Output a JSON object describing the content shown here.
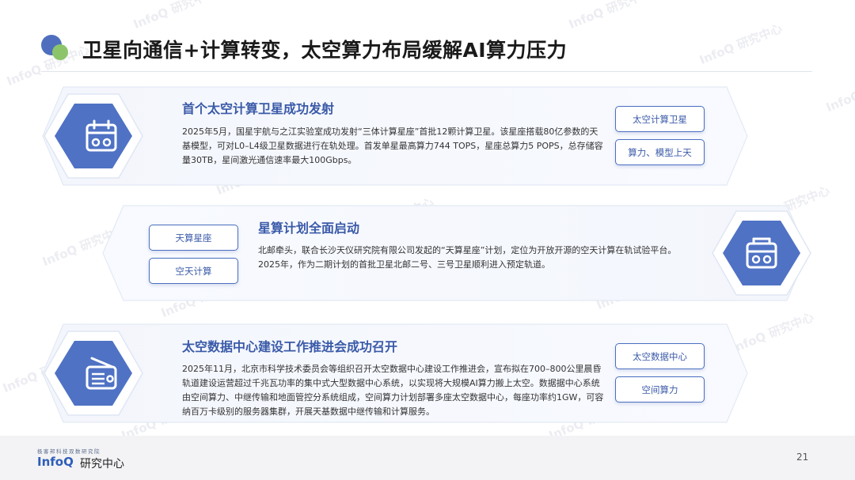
{
  "page": {
    "title": "卫星向通信+计算转变，太空算力布局缓解AI算力压力",
    "page_number": "21"
  },
  "watermark_text": "InfoQ 研究中心",
  "cards": [
    {
      "title": "首个太空计算卫星成功发射",
      "body": "2025年5月，国星宇航与之江实验室成功发射“三体计算星座”首批12颗计算卫星。该星座搭载80亿参数的天基模型，可对L0–L4级卫星数据进行在轨处理。首发单星最高算力744 TOPS，星座总算力5 POPS，总存储容量30TB，星间激光通信速率最大100Gbps。",
      "tags": [
        "太空计算卫星",
        "算力、模型上天"
      ],
      "icon": "calendar-icon"
    },
    {
      "title": "星算计划全面启动",
      "body": "北邮牵头，联合长沙天仪研究院有限公司发起的“天算星座”计划，定位为开放开源的空天计算在轨试验平台。2025年，作为二期计划的首批卫星北邮二号、三号卫星顺利进入预定轨道。",
      "tags": [
        "天算星座",
        "空天计算"
      ],
      "icon": "radio-icon"
    },
    {
      "title": "太空数据中心建设工作推进会成功召开",
      "body": "2025年11月，北京市科学技术委员会等组织召开太空数据中心建设工作推进会，宣布拟在700–800公里晨昏轨道建设运营超过千兆瓦功率的集中式大型数据中心系统，以实现将大规模AI算力搬上太空。数据据中心系统由空间算力、中继传输和地面管控分系统组成，空间算力计划部署多座太空数据中心，每座功率约1GW，可容纳百万卡级别的服务器集群，开展天基数据中继传输和计算服务。",
      "tags": [
        "太空数据中心",
        "空间算力"
      ],
      "icon": "antenna-radio-icon"
    }
  ],
  "footer": {
    "small_text": "极客邦科技双数研究院",
    "logo_en": "InfoQ",
    "logo_cn": "研究中心"
  },
  "colors": {
    "accent": "#3a5aa8",
    "hex_fill": "#4f72c4",
    "green": "#8cc46a"
  }
}
